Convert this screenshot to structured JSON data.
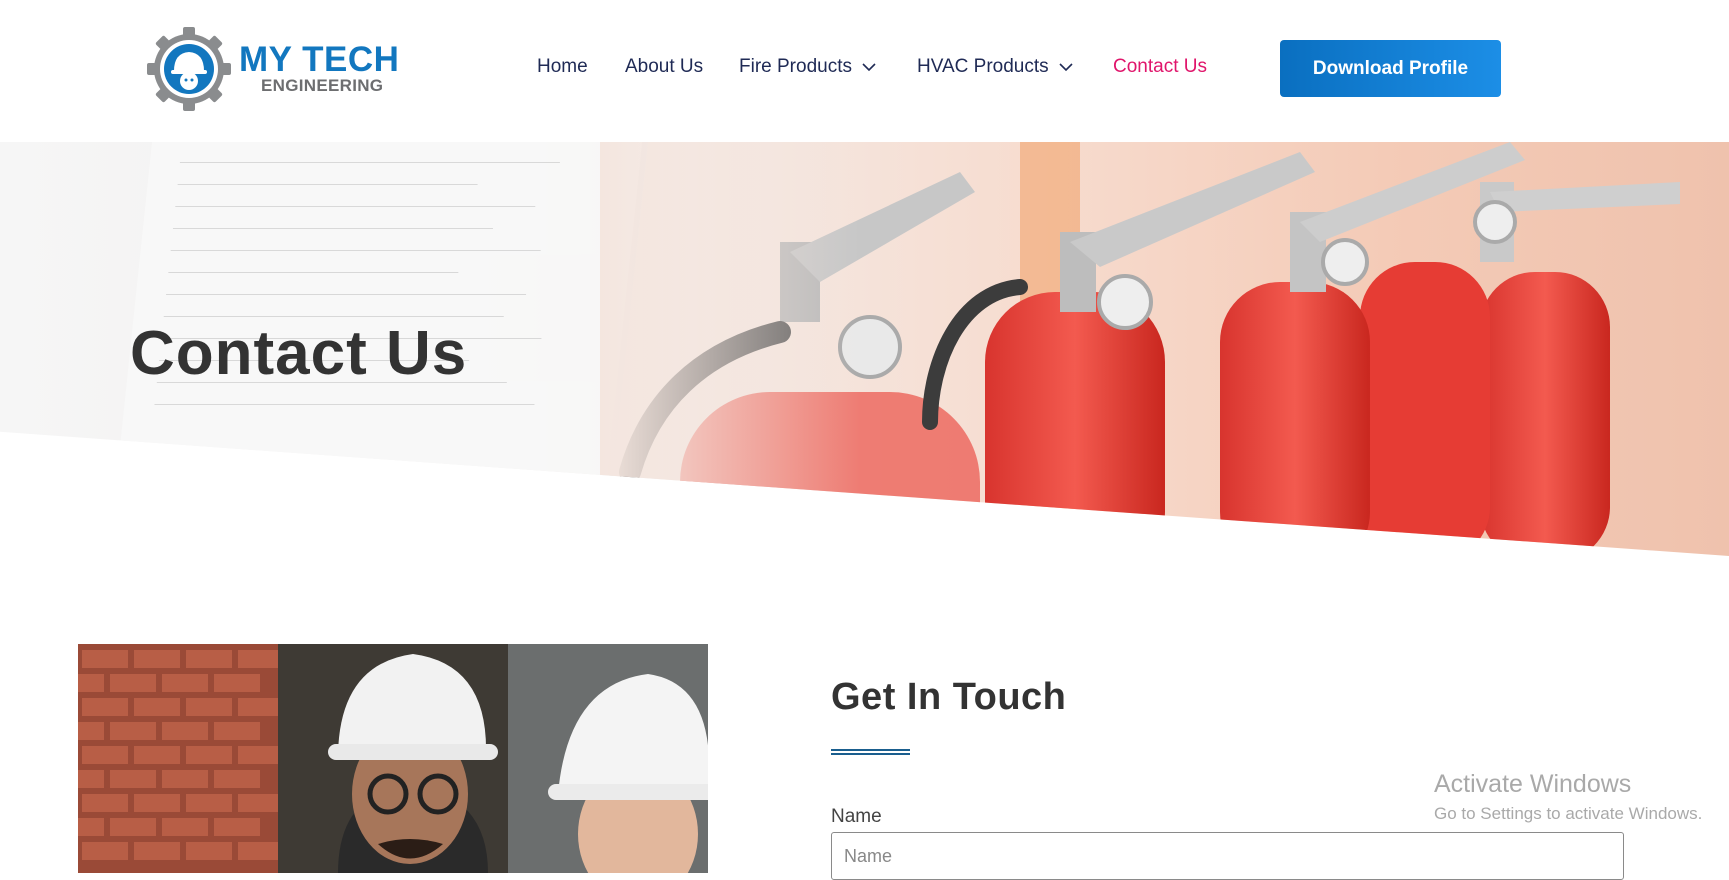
{
  "brand": {
    "name_line1": "MY TECH",
    "name_line2": "ENGINEERING",
    "logo_icon": "gear-helmet-logo",
    "primary_color": "#1277bf"
  },
  "nav": {
    "items": [
      {
        "label": "Home",
        "has_dropdown": false,
        "active": false
      },
      {
        "label": "About Us",
        "has_dropdown": false,
        "active": false
      },
      {
        "label": "Fire Products",
        "has_dropdown": true,
        "active": false
      },
      {
        "label": "HVAC Products",
        "has_dropdown": true,
        "active": false
      },
      {
        "label": "Contact Us",
        "has_dropdown": false,
        "active": true
      }
    ],
    "active_color": "#e0156b",
    "cta_label": "Download Profile"
  },
  "hero": {
    "title": "Contact Us",
    "image": "fire-extinguishers-inspection"
  },
  "content": {
    "photo": "engineers-in-hard-hats",
    "section_title": "Get In Touch",
    "form": {
      "name_label": "Name",
      "name_placeholder": "Name",
      "name_value": ""
    }
  },
  "watermark": {
    "title": "Activate Windows",
    "subtitle": "Go to Settings to activate Windows."
  }
}
